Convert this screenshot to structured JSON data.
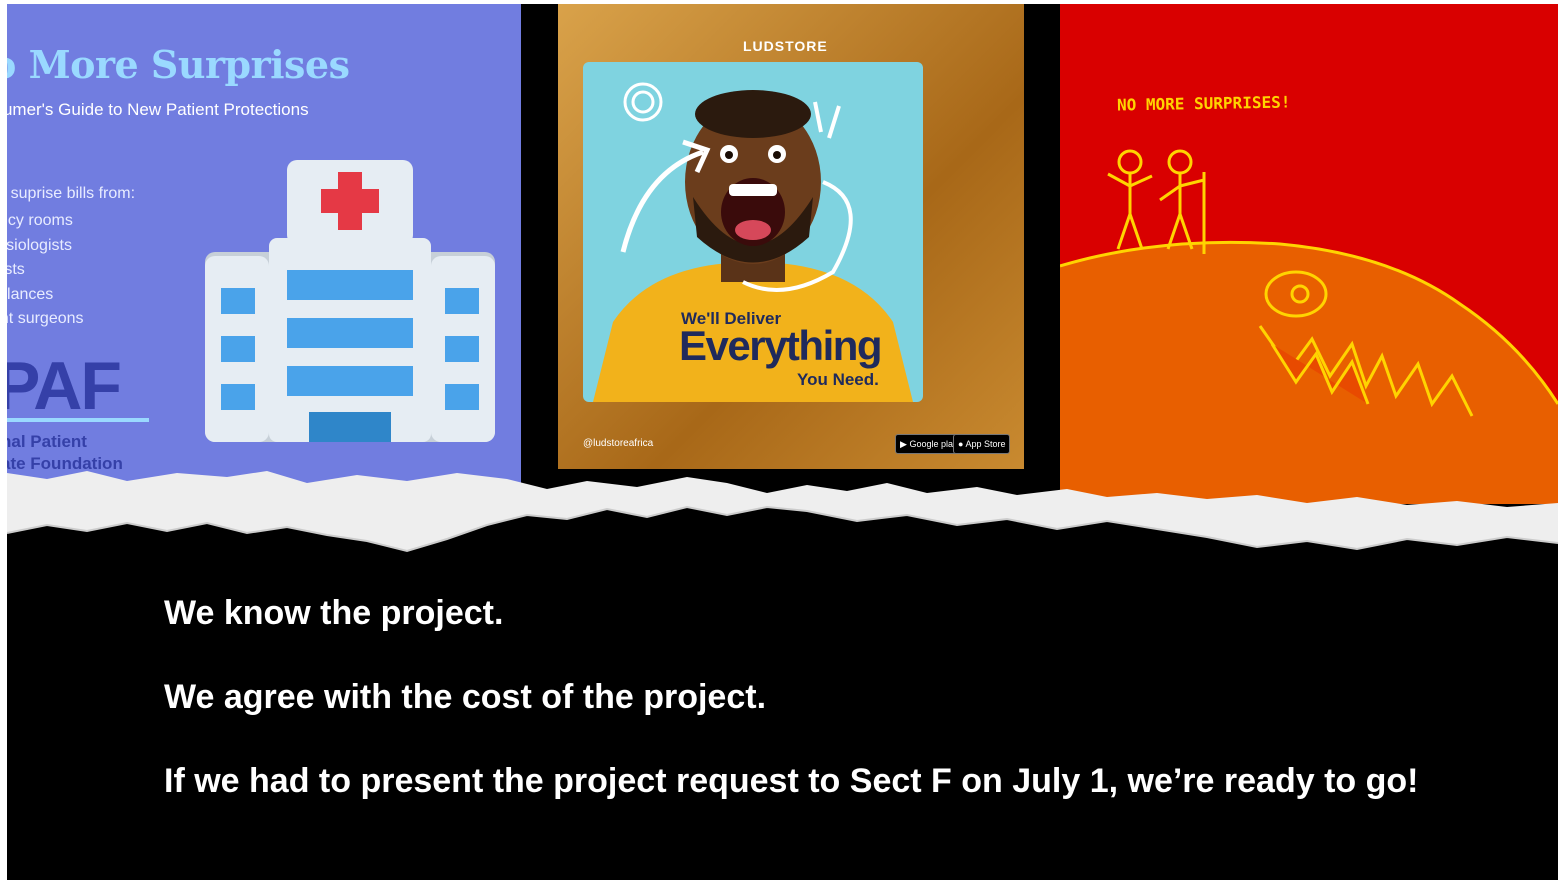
{
  "panel_left": {
    "title": "o More Surprises",
    "subtitle": "nsumer's Guide to New Patient Protections",
    "intro": "ore suprise bills from:",
    "items": [
      "ergency rooms",
      "esthesiologists",
      "iologists",
      "ambulances",
      "sistant surgeons"
    ],
    "logo_main": "PAF",
    "tagline_1": "nal Patient",
    "tagline_2": "ate Foundation",
    "colors": {
      "background": "#717de0",
      "accent": "#9ad9ff",
      "logo": "#3540a8"
    }
  },
  "panel_middle": {
    "brand": "LUDSTORE",
    "headline_1": "We'll Deliver",
    "headline_2": "Everything",
    "headline_3": "You Need.",
    "handle": "@ludstoreafrica",
    "badge_google": "Google play",
    "badge_apple": "App Store",
    "colors": {
      "shirt": "#f2b21b",
      "text": "#1f2a5c",
      "background": "#7fd3e0"
    }
  },
  "panel_right": {
    "caption": "NO MORE SURPRISES!",
    "colors": {
      "sky": "#d90000",
      "hill": "#e85f00",
      "ink": "#ffd400"
    }
  },
  "body": {
    "line_1": "We know the project.",
    "line_2": "We agree with the cost of the project.",
    "line_3": "If we had to present the project request to Sect F on July 1, we’re ready to go!"
  }
}
